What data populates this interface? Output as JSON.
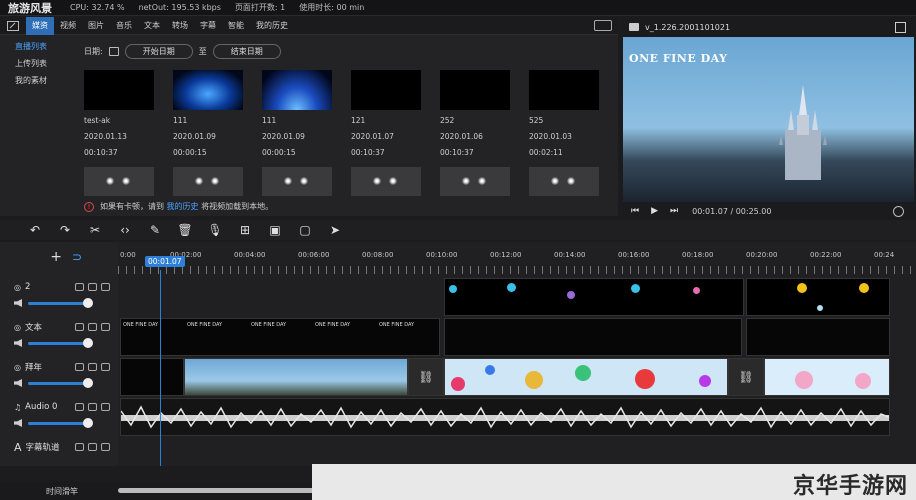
{
  "topbar": {
    "app_title": "旅游风景",
    "cpu": "CPU: 32.74 %",
    "net": "netOut: 195.53 kbps",
    "pages": "页面打开数: 1",
    "usage": "使用时长: 00 min"
  },
  "media_tabs": [
    "媒资",
    "视频",
    "图片",
    "音乐",
    "文本",
    "转场",
    "字幕",
    "智能",
    "我的历史"
  ],
  "media_side": [
    "直播列表",
    "上传列表",
    "我的素材"
  ],
  "date_filter": {
    "label": "日期:",
    "start": "开始日期",
    "to": "至",
    "end": "结束日期"
  },
  "media_items": [
    {
      "name": "test-ak",
      "date": "2020.01.13",
      "duration": "00:10:37",
      "thumb": "black"
    },
    {
      "name": "111",
      "date": "2020.01.09",
      "duration": "00:00:15",
      "thumb": "blue-screen"
    },
    {
      "name": "111",
      "date": "2020.01.09",
      "duration": "00:00:15",
      "thumb": "blue-glow"
    },
    {
      "name": "121",
      "date": "2020.01.07",
      "duration": "00:10:37",
      "thumb": "black"
    },
    {
      "name": "252",
      "date": "2020.01.06",
      "duration": "00:10:37",
      "thumb": "black"
    },
    {
      "name": "525",
      "date": "2020.01.03",
      "duration": "00:02:11",
      "thumb": "black"
    }
  ],
  "notice": {
    "prefix": "如果有卡顿，请到",
    "link": "我的历史",
    "suffix": "将视频加载到本地。"
  },
  "preview": {
    "version": "v_1.226.2001101021",
    "overlay_text": "ONE FINE DAY",
    "time": "00:01.07 / 00:25.00"
  },
  "ruler_labels": [
    "0:00",
    "00:02:00",
    "00:04:00",
    "00:06:00",
    "00:08:00",
    "00:10:00",
    "00:12:00",
    "00:14:00",
    "00:16:00",
    "00:18:00",
    "00:20:00",
    "00:22:00",
    "00:24"
  ],
  "playhead": "00:01.07",
  "tracks": [
    {
      "name": "2",
      "icon": "video-track-icon"
    },
    {
      "name": "文本",
      "icon": "video-track-icon"
    },
    {
      "name": "拜年",
      "icon": "video-track-icon"
    },
    {
      "name": "Audio 0",
      "icon": "music-icon"
    },
    {
      "name": "字幕轨道",
      "icon": "text-icon"
    }
  ],
  "mini_clip_label": "ONE FINE DAY",
  "bottom": {
    "scrub_label": "时间滑竿"
  },
  "watermark": "京华手游网",
  "colors": {
    "accent": "#2e7fd8",
    "active_tab": "#2e6fb8",
    "link": "#4aa3ff"
  }
}
